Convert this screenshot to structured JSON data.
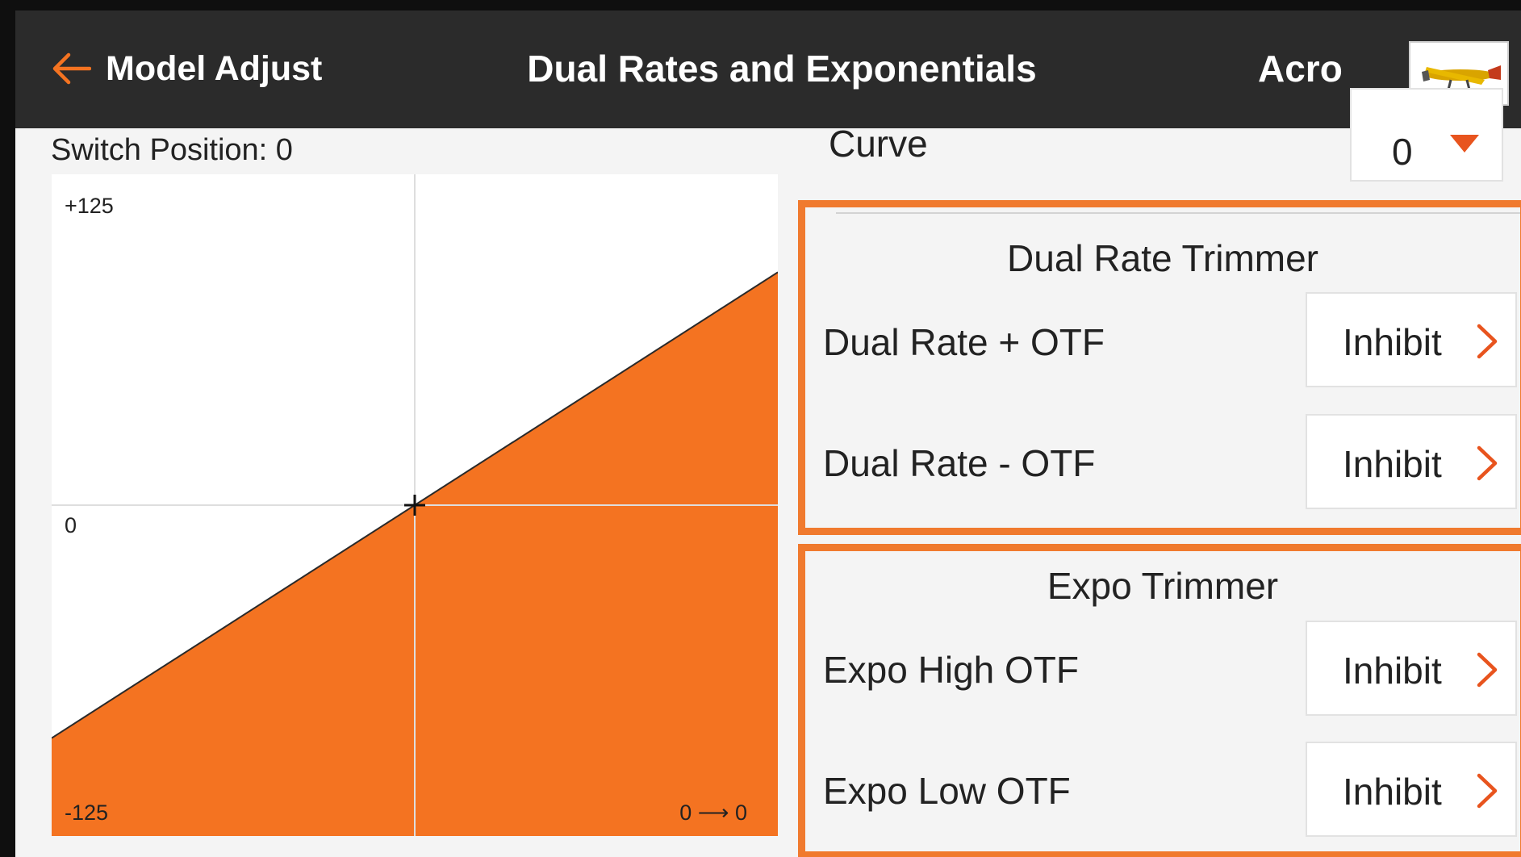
{
  "header": {
    "back_label": "Model Adjust",
    "title": "Dual Rates and Exponentials",
    "model_name": "Acro"
  },
  "left": {
    "switch_position": "Switch Position: 0"
  },
  "curve": {
    "label": "Curve",
    "value": "0"
  },
  "dual_rate_trimmer": {
    "title": "Dual Rate Trimmer",
    "rows": [
      {
        "label": "Dual Rate + OTF",
        "value": "Inhibit"
      },
      {
        "label": "Dual Rate - OTF",
        "value": "Inhibit"
      }
    ]
  },
  "expo_trimmer": {
    "title": "Expo Trimmer",
    "rows": [
      {
        "label": "Expo High OTF",
        "value": "Inhibit"
      },
      {
        "label": "Expo Low OTF",
        "value": "Inhibit"
      }
    ]
  },
  "chart_data": {
    "type": "area",
    "x": [
      -100,
      100
    ],
    "y": [
      -88,
      88
    ],
    "xlim": [
      -100,
      100
    ],
    "ylim": [
      -125,
      125
    ],
    "tick_labels": {
      "top": "+125",
      "middle": "0",
      "bottom": "-125"
    },
    "readout": "0 ⟶ 0",
    "grid": true,
    "fill_color": "#f47321"
  },
  "colors": {
    "accent": "#f47321",
    "header_bg": "#2b2b2b",
    "section_border": "#f07a2e"
  },
  "icons": {
    "back": "arrow-left-icon",
    "chevron": "chevron-right-icon",
    "caret": "caret-down-icon"
  }
}
